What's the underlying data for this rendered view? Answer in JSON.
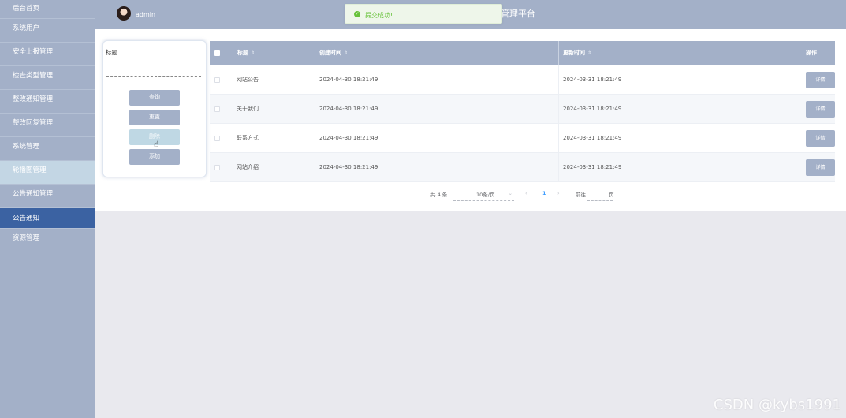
{
  "sidebar": {
    "items": [
      {
        "label": "后台首页"
      },
      {
        "label": "系统用户"
      },
      {
        "label": "安全上报管理"
      },
      {
        "label": "检查类型管理"
      },
      {
        "label": "整改通知管理"
      },
      {
        "label": "整改回复管理"
      },
      {
        "label": "系统管理"
      },
      {
        "label": "轮播图管理"
      },
      {
        "label": "公告通知管理"
      },
      {
        "label": "公告通知"
      },
      {
        "label": "资源管理"
      }
    ]
  },
  "header": {
    "user": "admin",
    "title": "管理平台"
  },
  "toast": {
    "icon": "check-circle-icon",
    "message": "提交成功!"
  },
  "search": {
    "label": "标题",
    "value": "",
    "query_label": "查询",
    "reset_label": "重置",
    "delete_label": "删除",
    "add_label": "添加"
  },
  "table": {
    "headers": {
      "title": "标题",
      "created": "创建时间",
      "updated": "更新时间",
      "action": "操作",
      "sort_icon": "⇕"
    },
    "rows": [
      {
        "title": "网站公告",
        "created": "2024-04-30 18:21:49",
        "updated": "2024-03-31 18:21:49",
        "action": "详情"
      },
      {
        "title": "关于我们",
        "created": "2024-04-30 18:21:49",
        "updated": "2024-03-31 18:21:49",
        "action": "详情"
      },
      {
        "title": "联系方式",
        "created": "2024-04-30 18:21:49",
        "updated": "2024-03-31 18:21:49",
        "action": "详情"
      },
      {
        "title": "网站介绍",
        "created": "2024-04-30 18:21:49",
        "updated": "2024-03-31 18:21:49",
        "action": "详情"
      }
    ]
  },
  "pagination": {
    "total": "共 4 条",
    "page_size": "10条/页",
    "prev": "‹",
    "current": "1",
    "next": "›",
    "goto_prefix": "前往",
    "goto_value": "",
    "goto_suffix": "页"
  },
  "watermark": "CSDN @kybs1991",
  "colors": {
    "sidebar_bg": "#a3b0c8",
    "active_item": "#3b62a2",
    "success": "#67c23a",
    "accent": "#409eff"
  }
}
